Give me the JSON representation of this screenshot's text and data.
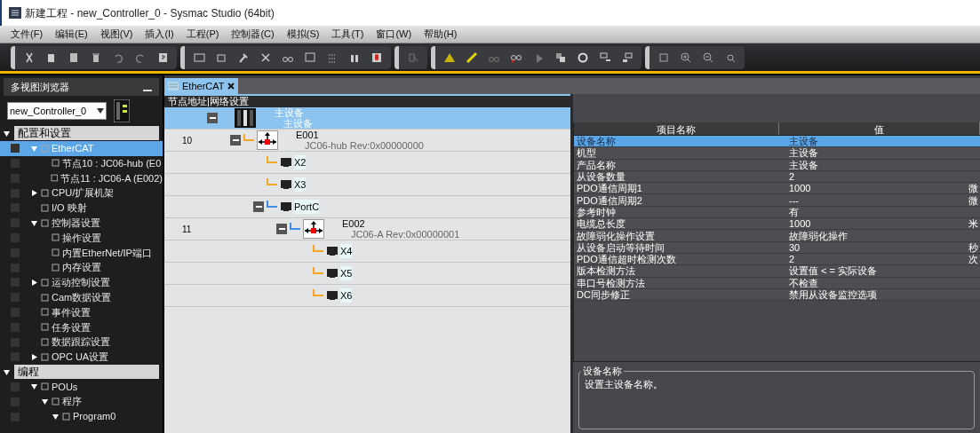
{
  "window": {
    "title": "新建工程 - new_Controller_0 - Sysmac Studio (64bit)"
  },
  "menu": [
    "文件(F)",
    "编辑(E)",
    "视图(V)",
    "插入(I)",
    "工程(P)",
    "控制器(C)",
    "模拟(S)",
    "工具(T)",
    "窗口(W)",
    "帮助(H)"
  ],
  "sidebar": {
    "title": "多视图浏览器",
    "controller": "new_Controller_0",
    "sections": [
      {
        "label": "配置和设置",
        "expanded": true,
        "items": [
          {
            "label": "EtherCAT",
            "expanded": true,
            "selected": true,
            "children": [
              {
                "label": "节点10 : JC06-hub (E0",
                "selected": false
              },
              {
                "label": "节点11 : JC06-A (E002)",
                "selected": false
              }
            ]
          },
          {
            "label": "CPU/扩展机架",
            "expanded": false,
            "selected": false
          },
          {
            "label": "I/O 映射",
            "selected": false
          },
          {
            "label": "控制器设置",
            "expanded": true,
            "selected": false,
            "children": [
              {
                "label": "操作设置",
                "selected": false
              },
              {
                "label": "内置EtherNet/IP端口",
                "selected": false
              },
              {
                "label": "内存设置",
                "selected": false
              }
            ]
          },
          {
            "label": "运动控制设置",
            "expanded": false,
            "selected": false
          },
          {
            "label": "Cam数据设置",
            "selected": false
          },
          {
            "label": "事件设置",
            "selected": false
          },
          {
            "label": "任务设置",
            "selected": false
          },
          {
            "label": "数据跟踪设置",
            "selected": false
          },
          {
            "label": "OPC UA设置",
            "expanded": false,
            "selected": false
          }
        ]
      },
      {
        "label": "编程",
        "expanded": true,
        "items": [
          {
            "label": "POUs",
            "expanded": true,
            "selected": false,
            "children": [
              {
                "label": "程序",
                "expanded": true,
                "selected": false,
                "children": [
                  {
                    "label": "Program0",
                    "expanded": true,
                    "selected": false
                  }
                ]
              }
            ]
          }
        ]
      }
    ]
  },
  "tabs": [
    {
      "label": "EtherCAT",
      "selected": true
    }
  ],
  "network": {
    "header": "节点地址|网络设置",
    "nodes": [
      {
        "kind": "master",
        "name": "主设备",
        "model": "主设备",
        "expanded": true,
        "selected": true,
        "children": [
          {
            "kind": "device",
            "address": "10",
            "name": "E001",
            "model": "JC06-hub Rev:0x00000000",
            "expanded": true,
            "selected": false,
            "color": "#f5a623",
            "children": [
              {
                "kind": "port",
                "name": "X2",
                "selected": false,
                "color": "#f5a623"
              },
              {
                "kind": "port",
                "name": "X3",
                "selected": false,
                "color": "#f5a623"
              },
              {
                "kind": "port",
                "name": "PortC",
                "expanded": true,
                "selected": false,
                "color": "#3b8fe8",
                "children": [
                  {
                    "kind": "device",
                    "address": "11",
                    "name": "E002",
                    "model": "JC06-A Rev:0x00000001",
                    "expanded": true,
                    "selected": false,
                    "color": "#3b8fe8",
                    "children": [
                      {
                        "kind": "port",
                        "name": "X4",
                        "selected": false,
                        "color": "#f5a623"
                      },
                      {
                        "kind": "port",
                        "name": "X5",
                        "selected": false,
                        "color": "#f5a623"
                      },
                      {
                        "kind": "port",
                        "name": "X6",
                        "selected": false,
                        "color": "#f5a623"
                      }
                    ]
                  }
                ]
              }
            ]
          }
        ]
      }
    ]
  },
  "properties": {
    "columns": [
      "项目名称",
      "值"
    ],
    "rows": [
      {
        "name": "设备名称",
        "value": "主设备",
        "selected": true
      },
      {
        "name": "机型",
        "value": "主设备",
        "selected": false
      },
      {
        "name": "产品名称",
        "value": "主设备",
        "selected": false
      },
      {
        "name": "从设备数量",
        "value": "2",
        "selected": false
      },
      {
        "name": "PDO通信周期1",
        "value": "1000",
        "unit": "微",
        "selected": false
      },
      {
        "name": "PDO通信周期2",
        "value": "---",
        "unit": "微",
        "selected": false
      },
      {
        "name": "参考时钟",
        "value": "有",
        "selected": false
      },
      {
        "name": "电缆总长度",
        "value": "1000",
        "unit": "米",
        "selected": false
      },
      {
        "name": "故障弱化操作设置",
        "value": "故障弱化操作",
        "selected": false
      },
      {
        "name": "从设备启动等待时间",
        "value": "30",
        "unit": "秒",
        "selected": false
      },
      {
        "name": "PDO通信超时检测次数",
        "value": "2",
        "unit": "次",
        "selected": false
      },
      {
        "name": "版本检测方法",
        "value": "设置值 < = 实际设备",
        "selected": false
      },
      {
        "name": "串口号检测方法",
        "value": "不检查",
        "selected": false
      },
      {
        "name": "DC同步修正",
        "value": "禁用从设备监控选项",
        "selected": false
      }
    ],
    "description": {
      "title": "设备名称",
      "text": "设置主设备名称。"
    }
  }
}
